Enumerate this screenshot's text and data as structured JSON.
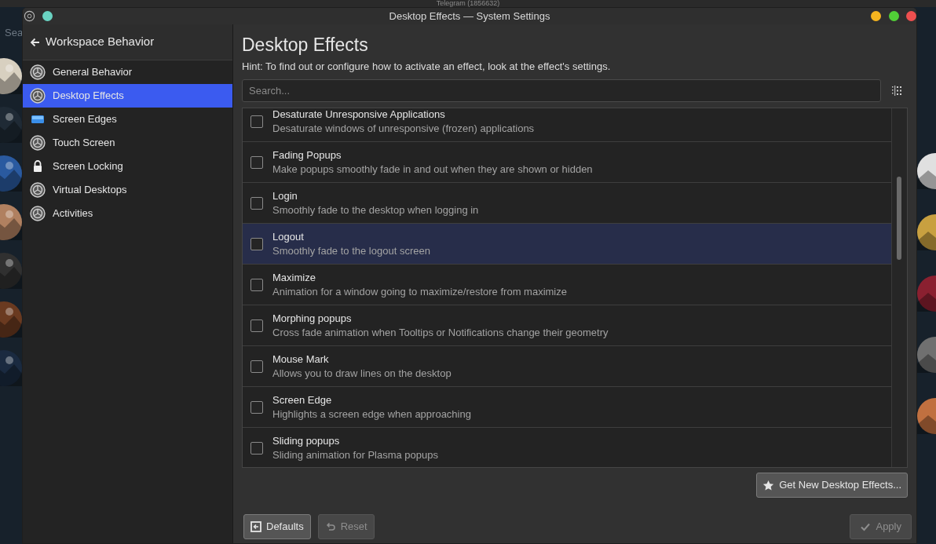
{
  "background_app": {
    "title": "Telegram (1856632)",
    "search_text": "Sea"
  },
  "window": {
    "title": "Desktop Effects — System Settings"
  },
  "sidebar": {
    "back_label": "Workspace Behavior",
    "items": [
      {
        "label": "General Behavior",
        "kind": "gear",
        "selected": false
      },
      {
        "label": "Desktop Effects",
        "kind": "gear",
        "selected": true
      },
      {
        "label": "Screen Edges",
        "kind": "screen",
        "selected": false
      },
      {
        "label": "Touch Screen",
        "kind": "gear",
        "selected": false
      },
      {
        "label": "Screen Locking",
        "kind": "lock",
        "selected": false
      },
      {
        "label": "Virtual Desktops",
        "kind": "gear",
        "selected": false
      },
      {
        "label": "Activities",
        "kind": "gear",
        "selected": false
      }
    ]
  },
  "page": {
    "title": "Desktop Effects",
    "hint": "Hint: To find out or configure how to activate an effect, look at the effect's settings.",
    "search": {
      "placeholder": "Search..."
    }
  },
  "effects": [
    {
      "name": "Desaturate Unresponsive Applications",
      "description": "Desaturate windows of unresponsive (frozen) applications",
      "checked": false,
      "selected": false
    },
    {
      "name": "Fading Popups",
      "description": "Make popups smoothly fade in and out when they are shown or hidden",
      "checked": false,
      "selected": false
    },
    {
      "name": "Login",
      "description": "Smoothly fade to the desktop when logging in",
      "checked": false,
      "selected": false
    },
    {
      "name": "Logout",
      "description": "Smoothly fade to the logout screen",
      "checked": false,
      "selected": true
    },
    {
      "name": "Maximize",
      "description": "Animation for a window going to maximize/restore from maximize",
      "checked": false,
      "selected": false
    },
    {
      "name": "Morphing popups",
      "description": "Cross fade animation when Tooltips or Notifications change their geometry",
      "checked": false,
      "selected": false
    },
    {
      "name": "Mouse Mark",
      "description": "Allows you to draw lines on the desktop",
      "checked": false,
      "selected": false
    },
    {
      "name": "Screen Edge",
      "description": "Highlights a screen edge when approaching",
      "checked": false,
      "selected": false
    },
    {
      "name": "Sliding popups",
      "description": "Sliding animation for Plasma popups",
      "checked": false,
      "selected": false
    }
  ],
  "get_new_button": {
    "label": "Get New Desktop Effects..."
  },
  "footer_buttons": [
    {
      "label": "Defaults",
      "kind": "defaults",
      "disabled": false
    },
    {
      "label": "Reset",
      "kind": "reset",
      "disabled": true
    },
    {
      "label": "Apply",
      "kind": "apply",
      "disabled": true
    }
  ]
}
